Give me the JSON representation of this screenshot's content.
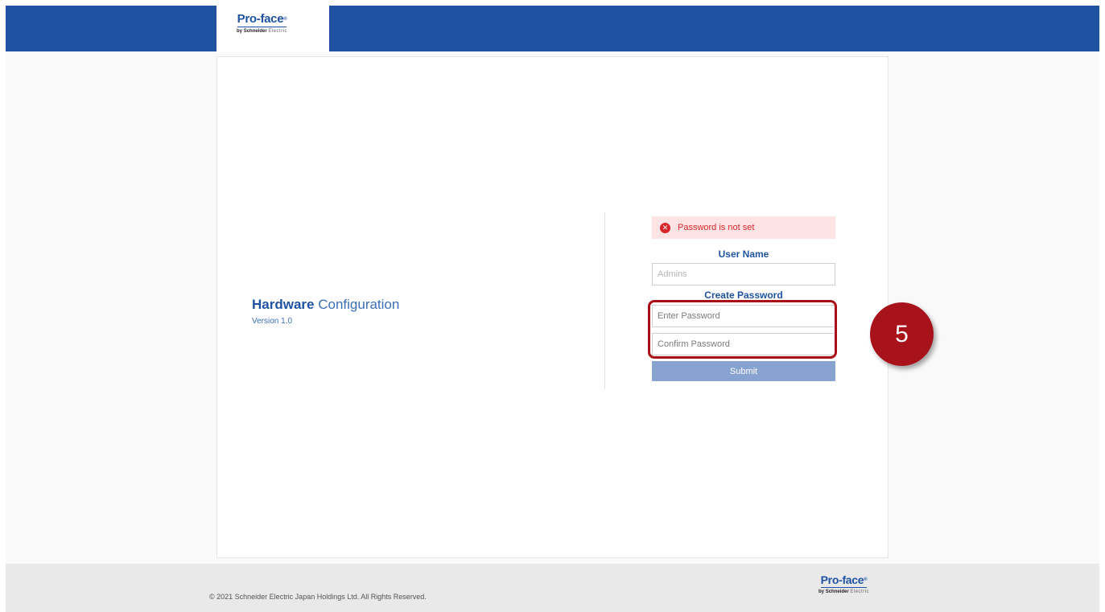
{
  "brand": {
    "logo_main": "Pro-face",
    "logo_by": "by",
    "logo_company": "Schneider",
    "logo_suffix": "Electric"
  },
  "app": {
    "title_bold": "Hardware",
    "title_rest": "Configuration",
    "version": "Version 1.0"
  },
  "alert": {
    "icon": "error-icon",
    "message": "Password is not set"
  },
  "form": {
    "user_name_label": "User Name",
    "user_name_placeholder": "Admins",
    "create_password_label": "Create Password",
    "enter_password_placeholder": "Enter Password",
    "confirm_password_placeholder": "Confirm Password",
    "submit_label": "Submit"
  },
  "annotation": {
    "step_number": "5"
  },
  "footer": {
    "copyright": "© 2021 Schneider Electric Japan Holdings Ltd. All Rights Reserved."
  },
  "colors": {
    "header_blue": "#1f53a1",
    "alert_red": "#d9262d",
    "highlight_red": "#a80f16",
    "submit_disabled": "#89a3d0"
  }
}
